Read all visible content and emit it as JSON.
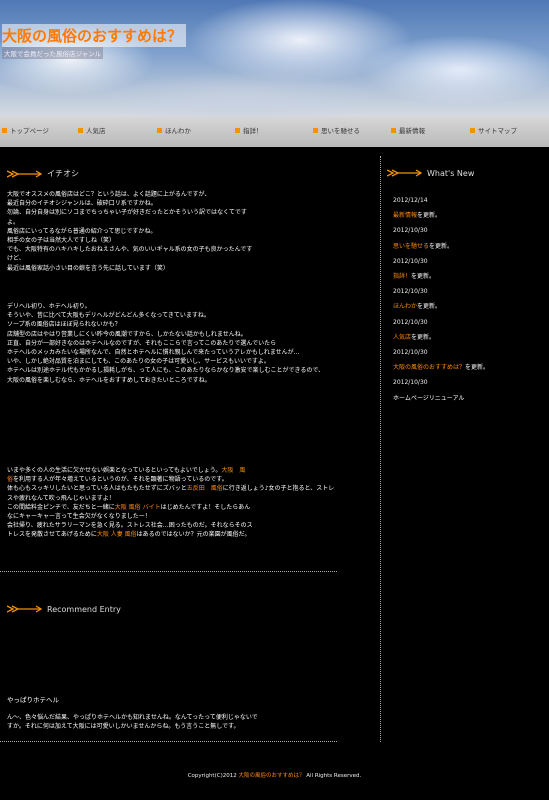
{
  "header": {
    "site_title": "大阪の風俗のおすすめは？",
    "subtitle": "大阪で会員だった風俗店ジャンル"
  },
  "nav": {
    "items": [
      "トップページ",
      "人気店",
      "ほんわか",
      "指詳！",
      "思いを馳せる",
      "最新情報",
      "サイトマップ"
    ]
  },
  "main": {
    "section_title": "イチオシ",
    "paragraph1": [
      "大阪でオススメの風俗店はどこ？という話は、よく話題に上がるんですが、",
      "最近自分のイチオシジャンルは、破砕口リ系ですかね。",
      "勿論、自分自身は別にソコまでちっちゃい子が好きだったとかそういう訳ではなくてです",
      "よ。",
      "風俗店にいってるながら普通の紹介って思じですかね。",
      "相手の女の子は当然大人ですしね（笑）",
      "でも、大阪特有のハキハキしたおねえさんや、気のいいギャル系の女の子も良かったんです",
      "けど、",
      "最近は風俗家話小さい目の娘を言う先に話しています（笑）"
    ],
    "paragraph2": [
      "デリヘル初り、ホテヘル初り。",
      "そういや、昔に比べて大阪もデリヘルがどんどん多くなってきていますね。",
      "ソープ系の風俗店はほぼ見られないかも？",
      "店舗型の店はやはり営業しにくい昨今の風潮ですから、しかたない話かもしれませんね。",
      "正直、自分が一部好きなのはホテヘルなのですが、それもここらで言ってこのあたりで選んでいたら",
      "ホテヘルのメッカみたいな場所なんで、自然とホテヘルに慣れ親しんで来たっていうアレかもしれませんが…",
      "いや、しかし絶対品質を泊まにしても、このあたりの女の子は可愛いし、サービスもいいですよ。",
      "ホテヘルは別途ホテル代もかかるし損耗しがち、って人にも、このあたりならかなり激安で楽しむことができるので、",
      "大阪の風俗を楽しむなら、ホテヘルをおすすめしておきたいところですね。"
    ],
    "paragraph3": {
      "l1_a": "いまや多くの人の生活に欠かせない娯楽となっているといってもよいでしょう。",
      "l1_hl": "大阪　風",
      "l2_hl": "俗",
      "l2_b": "を利用する人が年々増えているというのが、それを顕著に物語っているのです。",
      "l3_a": "体も心もスッキリしたいと思っている人はもたもたせずにズバッと",
      "l3_hl1": "五反田　風俗",
      "l3_b": "に行き返しょう♪女の子と抱ると、ストレスや疲れなんて吹っ飛んじゃいますよ！",
      "l4_a": "この間給料金ピンチで、友だちと一緒に",
      "l4_hl": "大阪 風俗 バイト",
      "l4_b": "はじめたんですよ！そしたらあん",
      "l5": "なにキャーキャー言って生会欠がなくなりましたー！",
      "l6": "会社帰り、疲れたサラリーマンを急く見る。ストレス社会…困ったものだ。それならそのス",
      "l7_a": "トレスを発散させてあげるために",
      "l7_hl": "大阪 人妻 風俗",
      "l7_b": "はあるのではないか？元の楽園が風俗だ。"
    },
    "recommend_title": "Recommend Entry",
    "entry_title": "やっぱりホテヘル",
    "entry_text": [
      "ん～、色々悩んだ結果、やっぱりホテヘルかも知れませんね。なんてったって便利じゃないで",
      "すか。それに何は加えて大阪には可愛いしかいませんからね。もう言うこと無しです。"
    ]
  },
  "sidebar": {
    "title": "What's New",
    "news": [
      {
        "date": "2012/12/14",
        "link": "最新情報",
        "tail": "を更新。"
      },
      {
        "date": "2012/10/30",
        "link": "思いを馳せる",
        "tail": "を更新。"
      },
      {
        "date": "2012/10/30",
        "link": "指詳！",
        "tail": "を更新。"
      },
      {
        "date": "2012/10/30",
        "link": "ほんわか",
        "tail": "を更新。"
      },
      {
        "date": "2012/10/30",
        "link": "人気店",
        "tail": "を更新。"
      },
      {
        "date": "2012/10/30",
        "link": "大阪の風俗のおすすめは？",
        "tail": "を更新。"
      },
      {
        "date": "2012/10/30",
        "link": "",
        "tail": "ホームページリニューアル"
      }
    ]
  },
  "footer": {
    "copy_a": "Copyright(C)2012 ",
    "copy_hl": "大阪の風俗のおすすめは？",
    "copy_b": " All Rights Reserved."
  },
  "colors": {
    "accent": "#ff8c00",
    "nav_square": "#f39200",
    "background": "#000000"
  }
}
